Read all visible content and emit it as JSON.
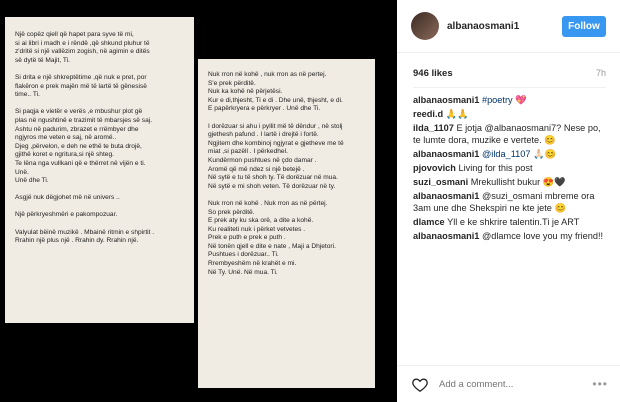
{
  "photo": {
    "left_page_paragraphs": [
      "Një copëz qiell që hapet para syve të mi,\nsi ai libri i madh e i rëndë ,që shkund pluhur të\nz'dritë si një vallëzim zogish, në agimin e ditës\nsë dytë të Majit, Ti.",
      "Si drita e një shkreptëtime ,që nuk e pret, por\nflakëron e prek majën më të lartë të gënesisë\ntime.. Ti.",
      "Si paqja e vietër e verës ,e mbushur plot gë\nplas në ngushtinë e trazimit të mbarsjes së saj.\nAshtu në padurim, zbrazet e rrëmbyer dhe\nngjyros me veten e saj, në aromë..\nDjeg ,përvelon, e deh ne ethë te buta drojë,\ngjithë koret e ngritura,si një shteg.\nTe lëna nga vullkani që e thërret në vijën e ti.\nUnë.\nUnë dhe Ti.",
      "Asgjë nuk dëgjohet më në univers ..",
      "Një përkryeshmëri e pakompozuar.",
      "Valyulat bëinë muzikë . Mbainë ritmin e shpirtit .\nRrahin një plus një . Rrahin dy. Rrahin një."
    ],
    "right_page_paragraphs": [
      "Nuk rron në kohë , nuk rron as në pertej.\nS'e prek përditë.\nNuk ka kohë në përjetësi.\nKur e di,thjesht, Ti e di . Dhe unë, thjesht, e di.\nE papërkryera e përkryer . Unë dhe Ti.",
      "I dorëzuar si ahu i pyllit më të dëndur , në stolj\ngjethesh pafund . I lartë i drejtë i fortë.\nNgjitem dhe kombinoj ngjyrat e gjetheve me të\nmiat ,si pazëll . I përkedhel.\nKundërmon pushtues në çdo damar .\nAromë që më ndez si një betejë .\nNë sytë e tu të shoh ty. Të dorëzuar në mua.\nNë sytë e mi shoh veten. Të dorëzuar në ty.",
      "Nuk rron në kohë . Nuk rron as në përtej.\nSo prek përditë.\nE prek aty ku ska orë, a dite a kohë.\nKu realiteti nuk i përket vetvetes .\nPrek e puth e prek e puth .\nNë tonën qjell e dite e nate , Maji a Dhjetori.\nPushtues i dorëzuar.. Ti.\nRrembyeshëm në krahët e mi.\nNë Ty. Unë. Në mua. Ti."
    ]
  },
  "post": {
    "username": "albanaosmani1",
    "follow_label": "Follow",
    "likes": "946 likes",
    "age": "7h",
    "comments": [
      {
        "user": "albanaosmani1",
        "text": "#poetry 💖"
      },
      {
        "user": "reedi.d",
        "text": "🙏🙏"
      },
      {
        "user": "ilda_1107",
        "text": "E jotja @albanaosmani7? Nese po, te lumte dora, muzike e vertete. 😊"
      },
      {
        "user": "albanaosmani1",
        "text": "@ilda_1107 🙏🏻😊"
      },
      {
        "user": "pjovovich",
        "text": "Living for this post"
      },
      {
        "user": "suzi_osmani",
        "text": "Mrekullisht bukur 😍🖤"
      },
      {
        "user": "albanaosmani1",
        "text": "@suzi_osmani mbreme ora 3am une dhe Shekspiri ne kte jete 😊"
      },
      {
        "user": "dlamce",
        "text": "Yll e ke shkrire talentin.Ti je ART"
      },
      {
        "user": "albanaosmani1",
        "text": "@dlamce love you my friend!!"
      }
    ],
    "add_comment_placeholder": "Add a comment...",
    "more_label": "•••"
  },
  "colors": {
    "follow_blue": "#3897f0",
    "mention_blue": "#003569"
  },
  "icons": {
    "like": "heart-outline-icon",
    "more": "ellipsis-icon"
  }
}
